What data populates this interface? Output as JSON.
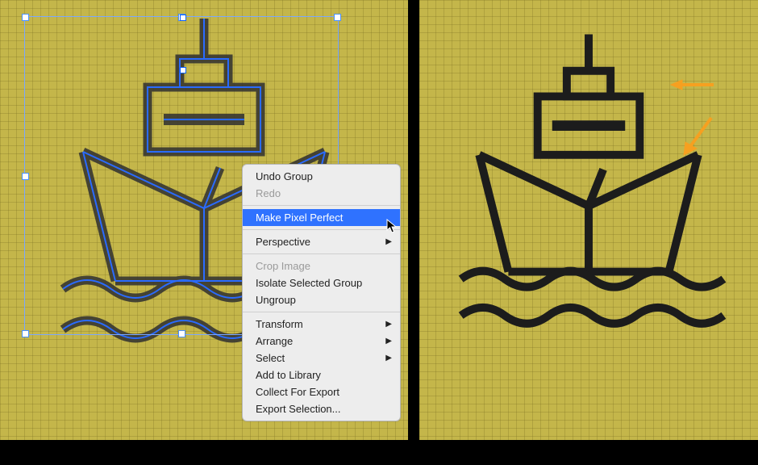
{
  "colors": {
    "canvas_bg": "#c4b64a",
    "grid_line": "#aa9b30",
    "selection": "#4a90ff",
    "menu_bg": "#ededed",
    "menu_highlight": "#2f72ff",
    "annotation_arrow": "#f6a020",
    "ship_stroke_left": "#2c2c2c",
    "ship_stroke_right": "#1a1a1a"
  },
  "menu": {
    "items": [
      {
        "label": "Undo Group",
        "enabled": true,
        "highlighted": false,
        "submenu": false
      },
      {
        "label": "Redo",
        "enabled": false,
        "highlighted": false,
        "submenu": false
      },
      {
        "separator": true
      },
      {
        "label": "Make Pixel Perfect",
        "enabled": true,
        "highlighted": true,
        "submenu": false
      },
      {
        "separator": true
      },
      {
        "label": "Perspective",
        "enabled": true,
        "highlighted": false,
        "submenu": true
      },
      {
        "separator": true
      },
      {
        "label": "Crop Image",
        "enabled": false,
        "highlighted": false,
        "submenu": false
      },
      {
        "label": "Isolate Selected Group",
        "enabled": true,
        "highlighted": false,
        "submenu": false
      },
      {
        "label": "Ungroup",
        "enabled": true,
        "highlighted": false,
        "submenu": false
      },
      {
        "separator": true
      },
      {
        "label": "Transform",
        "enabled": true,
        "highlighted": false,
        "submenu": true
      },
      {
        "label": "Arrange",
        "enabled": true,
        "highlighted": false,
        "submenu": true
      },
      {
        "label": "Select",
        "enabled": true,
        "highlighted": false,
        "submenu": true
      },
      {
        "label": "Add to Library",
        "enabled": true,
        "highlighted": false,
        "submenu": false
      },
      {
        "label": "Collect For Export",
        "enabled": true,
        "highlighted": false,
        "submenu": false
      },
      {
        "label": "Export Selection...",
        "enabled": true,
        "highlighted": false,
        "submenu": false
      }
    ]
  },
  "annotations": {
    "arrow1": "points at cabin corner (before/after pixel snap)",
    "arrow2": "points at hull edge (before/after pixel snap)"
  }
}
